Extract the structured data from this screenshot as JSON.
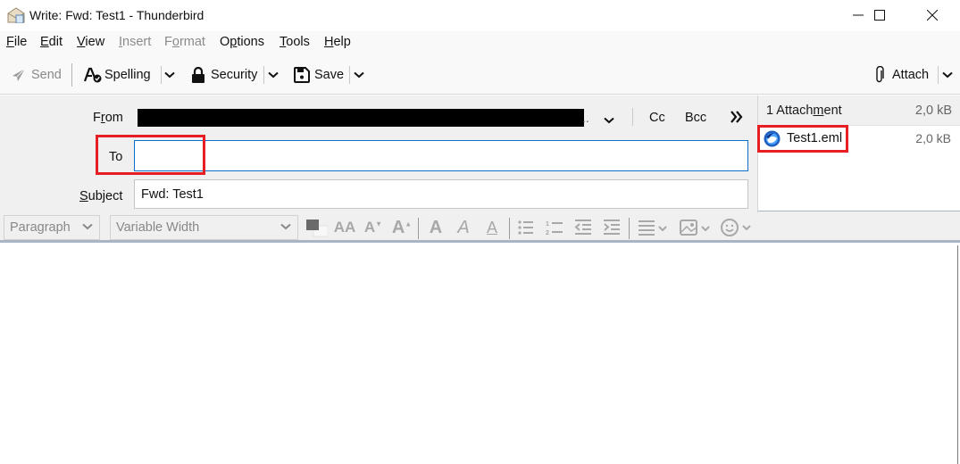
{
  "window": {
    "title": "Write: Fwd: Test1 - Thunderbird",
    "app_icon": "compose-envelope-icon",
    "controls": [
      "minimize-icon",
      "maximize-icon",
      "close-icon"
    ]
  },
  "menubar": {
    "items": [
      {
        "label": "File",
        "accel": "F",
        "enabled": true
      },
      {
        "label": "Edit",
        "accel": "E",
        "enabled": true
      },
      {
        "label": "View",
        "accel": "V",
        "enabled": true
      },
      {
        "label": "Insert",
        "accel": "I",
        "enabled": false
      },
      {
        "label": "Format",
        "accel": "o",
        "enabled": false
      },
      {
        "label": "Options",
        "accel": "p",
        "enabled": true
      },
      {
        "label": "Tools",
        "accel": "T",
        "enabled": true
      },
      {
        "label": "Help",
        "accel": "H",
        "enabled": true
      }
    ]
  },
  "toolbar": {
    "send_label": "Send",
    "spelling_label": "Spelling",
    "security_label": "Security",
    "save_label": "Save",
    "attach_label": "Attach"
  },
  "header": {
    "from_label": "From",
    "from_value_redacted": true,
    "from_ellipsis": "..",
    "cc_label": "Cc",
    "bcc_label": "Bcc",
    "more_fields_icon": "double-chevron-right-icon",
    "to_label": "To",
    "to_value": "",
    "subject_label": "Subject",
    "subject_value": "Fwd: Test1"
  },
  "attachments": {
    "header_label": "1 Attachment",
    "total_size": "2,0 kB",
    "items": [
      {
        "name": "Test1.eml",
        "size": "2,0 kB",
        "icon": "thunderbird-message-icon"
      }
    ]
  },
  "format_toolbar": {
    "paragraph_format": "Paragraph",
    "font_family": "Variable Width",
    "buttons": [
      "text-color-icon",
      "font-size-reset-icon",
      "font-size-smaller-icon",
      "font-size-larger-icon",
      "bold-icon",
      "italic-icon",
      "underline-icon",
      "bulleted-list-icon",
      "numbered-list-icon",
      "outdent-icon",
      "indent-icon",
      "align-icon",
      "insert-image-icon",
      "insert-emoji-icon"
    ]
  },
  "highlight_color": "#e81e25",
  "accent_color": "#0a70c9",
  "message_body": ""
}
